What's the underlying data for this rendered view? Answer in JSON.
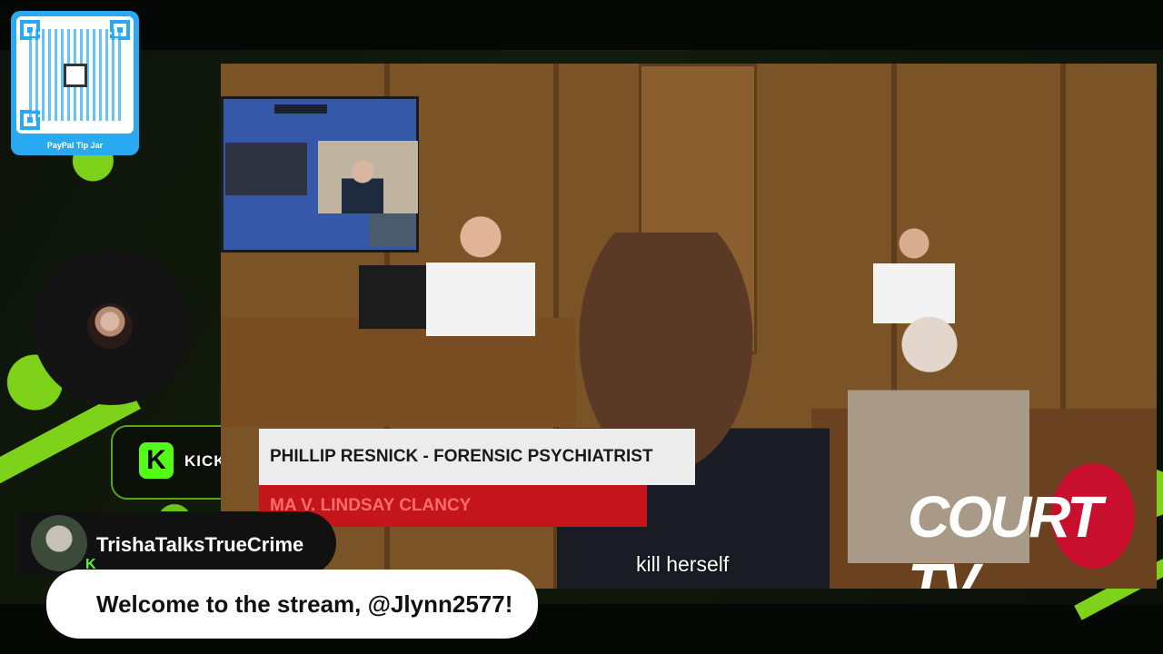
{
  "tip_jar": {
    "label": "PayPal Tip Jar",
    "accent_color": "#29a9f1"
  },
  "kick": {
    "logo_letter": "K",
    "label": "KICK"
  },
  "stream": {
    "lower_third_name": "PHILLIP RESNICK - FORENSIC PSYCHIATRIST",
    "lower_third_case": "MA V. LINDSAY CLANCY",
    "caption": "kill herself",
    "logo_text": "COURT TV"
  },
  "chat": {
    "username": "TrishaTalksTrueCrime",
    "message": "Welcome to the stream, @Jlynn2577!"
  },
  "colors": {
    "kick_green": "#53fc18",
    "lower_third_red": "#c4141c",
    "court_tv_red": "#c8102e"
  }
}
